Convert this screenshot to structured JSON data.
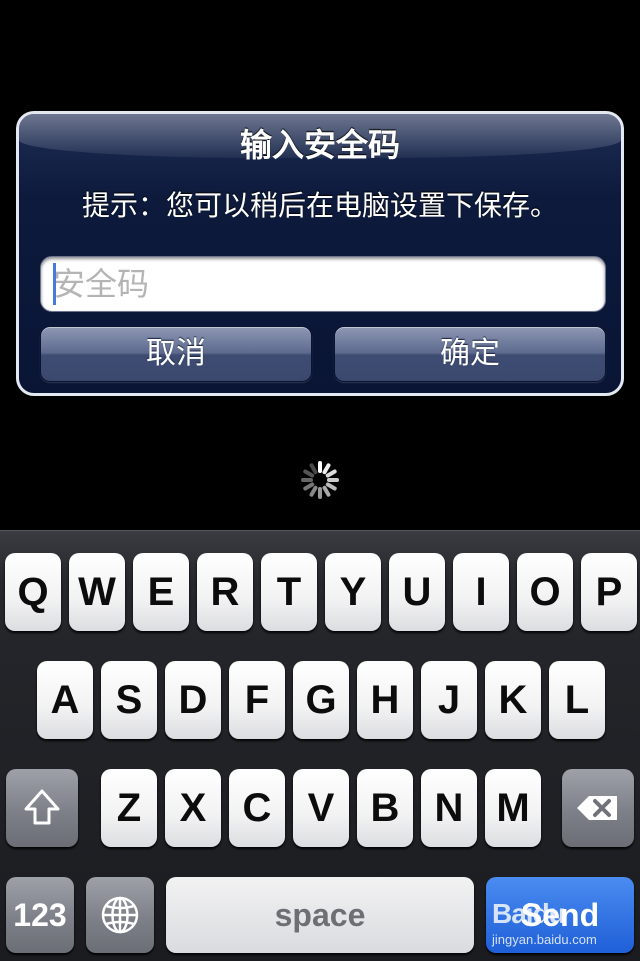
{
  "alert": {
    "title": "输入安全码",
    "message": "提示：您可以稍后在电脑设置下保存。",
    "input": {
      "value": "",
      "placeholder": "安全码"
    },
    "cancel_label": "取消",
    "confirm_label": "确定"
  },
  "keyboard": {
    "row1": [
      "Q",
      "W",
      "E",
      "R",
      "T",
      "Y",
      "U",
      "I",
      "O",
      "P"
    ],
    "row2": [
      "A",
      "S",
      "D",
      "F",
      "G",
      "H",
      "J",
      "K",
      "L"
    ],
    "row3": [
      "Z",
      "X",
      "C",
      "V",
      "B",
      "N",
      "M"
    ],
    "numbers_label": "123",
    "space_label": "space",
    "send_label": "Send",
    "shift_icon": "shift-icon",
    "delete_icon": "backspace-icon",
    "globe_icon": "globe-icon"
  },
  "watermark": {
    "logo": "Baidu",
    "url": "jingyan.baidu.com"
  }
}
